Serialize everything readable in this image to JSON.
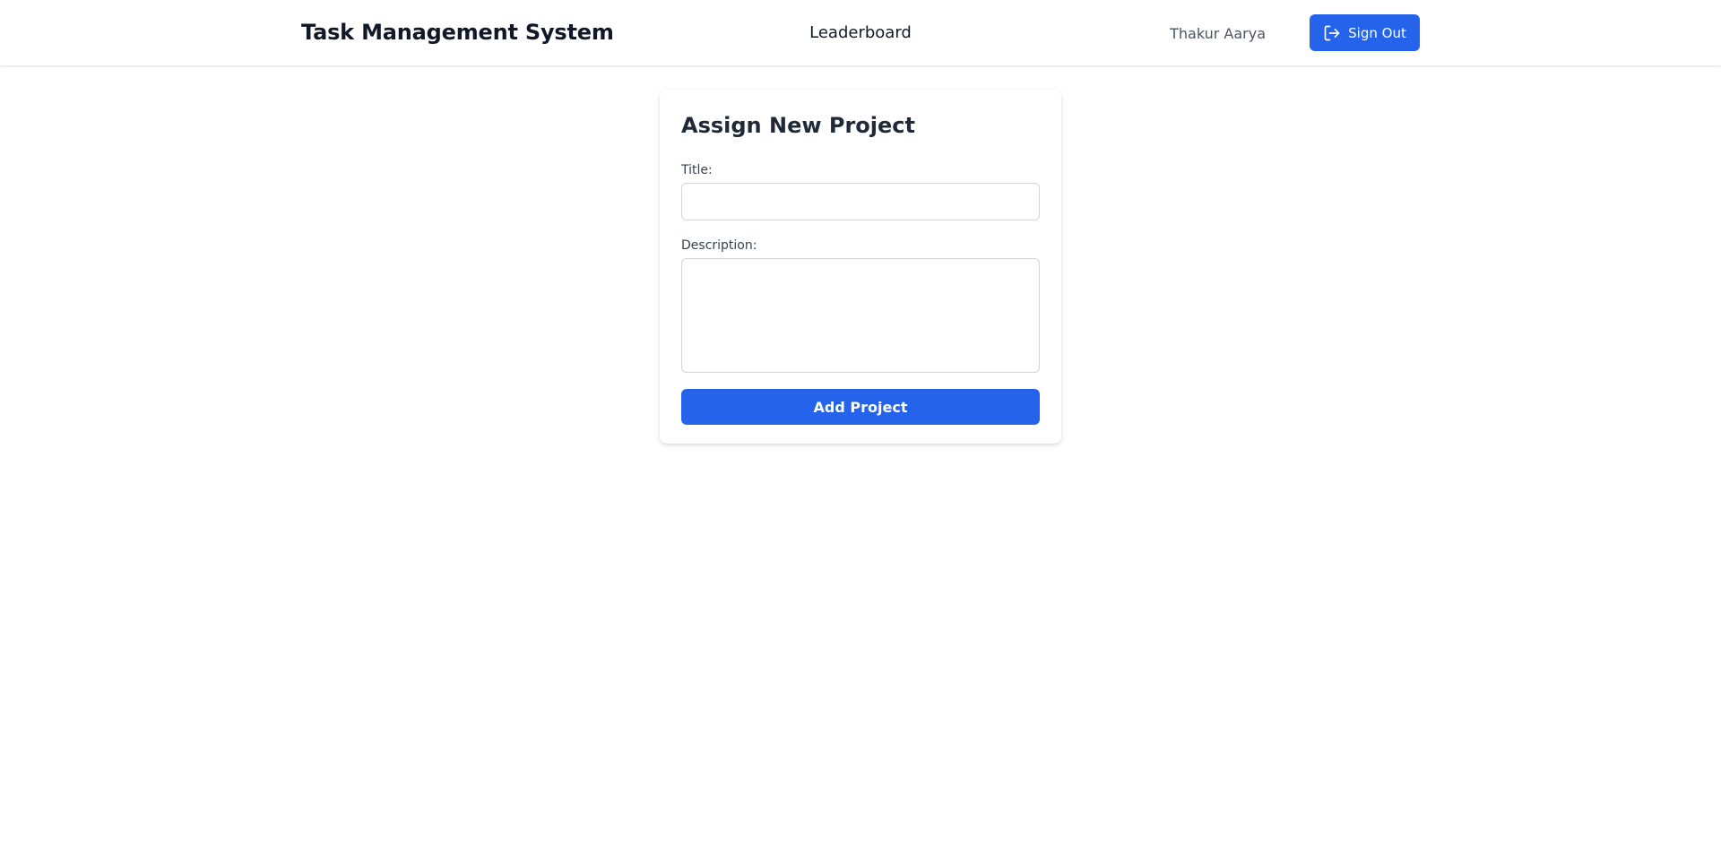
{
  "navbar": {
    "brand": "Task Management System",
    "links": [
      {
        "label": "Leaderboard"
      }
    ],
    "user_name": "Thakur Aarya",
    "signout_label": "Sign Out",
    "signout_icon": "sign-out-icon"
  },
  "form": {
    "title": "Assign New Project",
    "title_label": "Title:",
    "title_value": "",
    "description_label": "Description:",
    "description_value": "",
    "submit_label": "Add Project"
  },
  "colors": {
    "accent": "#2563eb",
    "text": "#111827",
    "muted": "#4b5563",
    "border": "#d1d5db"
  }
}
